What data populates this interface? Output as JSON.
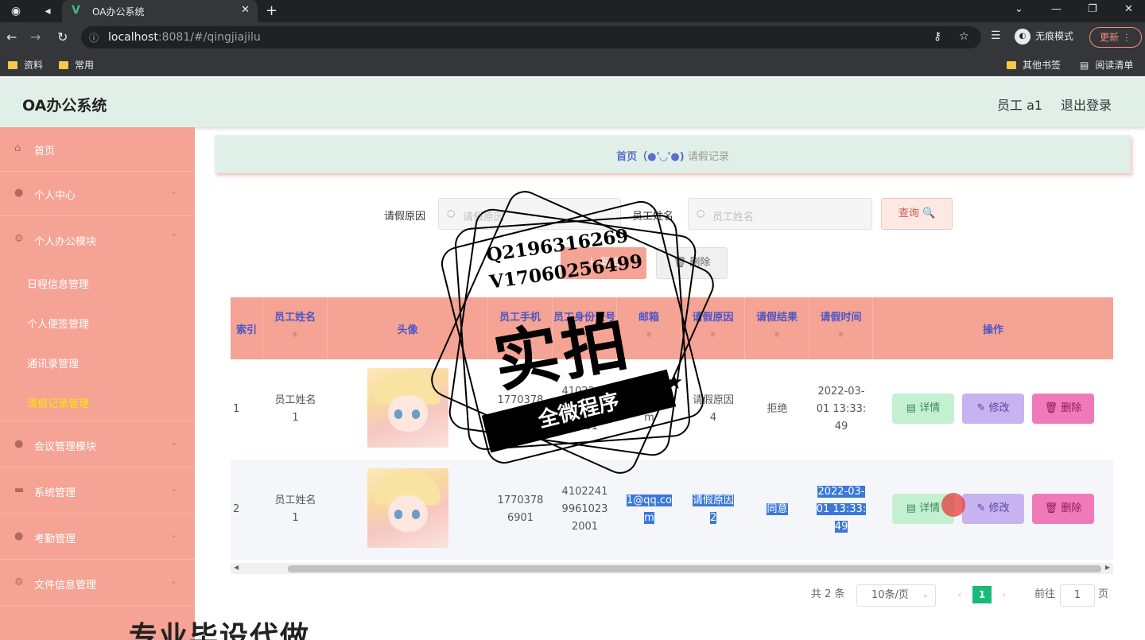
{
  "browser": {
    "tab_title": "OA办公系统",
    "url_host": "localhost",
    "url_rest": ":8081/#/qingjiajilu",
    "incognito_label": "无痕模式",
    "update_label": "更新",
    "bookmarks": [
      "资料",
      "常用"
    ],
    "bookmarks_right": [
      "其他书签",
      "阅读清单"
    ]
  },
  "header": {
    "title": "OA办公系统",
    "user": "员工 a1",
    "logout": "退出登录"
  },
  "sidebar": {
    "items": [
      {
        "label": "首页",
        "icon": "home-icon"
      },
      {
        "label": "个人中心",
        "icon": "user-icon"
      },
      {
        "label": "个人办公模块",
        "icon": "settings-icon"
      },
      {
        "label": "会议管理模块",
        "icon": "user-icon"
      },
      {
        "label": "系统管理",
        "icon": "message-icon"
      },
      {
        "label": "考勤管理",
        "icon": "user-icon"
      },
      {
        "label": "文件信息管理",
        "icon": "settings-icon"
      }
    ],
    "sub_items": [
      "日程信息管理",
      "个人便签管理",
      "通讯录管理",
      "请假记录管理"
    ]
  },
  "breadcrumb": {
    "home": "首页（●'◡'●)",
    "current": "请假记录"
  },
  "search": {
    "reason_label": "请假原因",
    "reason_placeholder": "请假原因",
    "name_label": "员工姓名",
    "name_placeholder": "员工姓名",
    "query_btn": "查询 🔍"
  },
  "actions": {
    "add": "新增",
    "delete": "删除"
  },
  "table": {
    "headers": [
      "索引",
      "员工姓名",
      "头像",
      "员工手机",
      "员工身份证号",
      "邮箱",
      "请假原因",
      "请假结果",
      "请假时间",
      "操作"
    ],
    "rows": [
      {
        "index": "1",
        "name": "员工姓名1",
        "phone": "17703786901",
        "idcard": "410224199610232001",
        "email": "1@qq.com",
        "reason": "请假原因4",
        "result": "拒绝",
        "time": "2022-03-01 13:33:49"
      },
      {
        "index": "2",
        "name": "员工姓名1",
        "phone": "17703786901",
        "idcard": "410224199610232001",
        "email": "1@qq.com",
        "reason": "请假原因2",
        "result": "同意",
        "time": "2022-03-01 13:33:49"
      }
    ],
    "op_detail": "详情",
    "op_edit": "修改",
    "op_delete": "删除"
  },
  "pagination": {
    "total": "共 2 条",
    "page_size": "10条/页",
    "current_page": "1",
    "goto_label": "前往",
    "goto_value": "1",
    "page_suffix": "页"
  },
  "watermark": {
    "qq": "Q2196316269",
    "vx": "V17060256499",
    "big": "实拍",
    "band": "全微程序",
    "banner": "专业毕设代做"
  }
}
